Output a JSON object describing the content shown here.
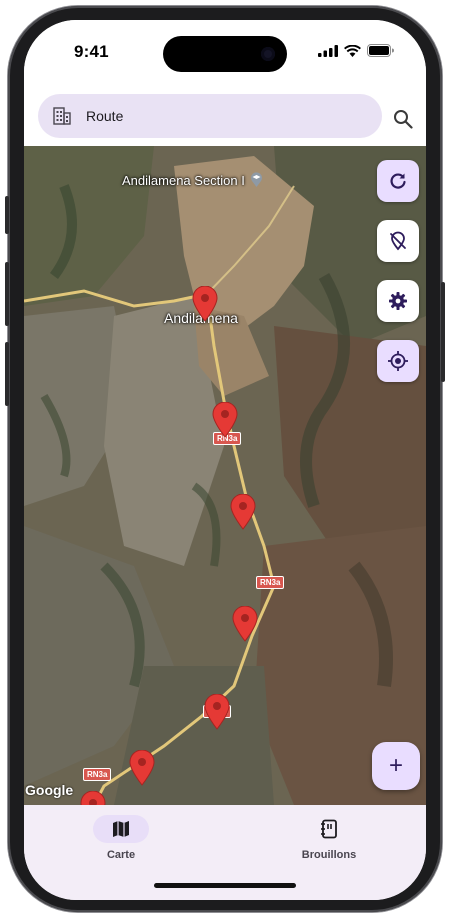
{
  "status_bar": {
    "time": "9:41"
  },
  "search": {
    "value": "Route"
  },
  "map": {
    "place_section": "Andilamena Section I",
    "place_town": "Andilamena",
    "road_tag": "RN3a",
    "attribution": "Google",
    "pin_count": 7
  },
  "map_controls": [
    {
      "name": "refresh",
      "icon": "refresh-icon"
    },
    {
      "name": "location-off",
      "icon": "location-off-icon"
    },
    {
      "name": "settings",
      "icon": "gear-icon"
    },
    {
      "name": "my-location",
      "icon": "my-location-icon"
    }
  ],
  "fab": {
    "label": "+"
  },
  "bottom_nav": {
    "items": [
      {
        "label": "Carte",
        "icon": "map-icon",
        "active": true
      },
      {
        "label": "Brouillons",
        "icon": "drafts-icon",
        "active": false
      }
    ]
  },
  "colors": {
    "accent_container": "#e9ddff",
    "search_background": "#e9e2f4",
    "nav_background": "#f3edf7",
    "pin_red": "#e53935",
    "icon_dark": "#2e1d5c"
  }
}
